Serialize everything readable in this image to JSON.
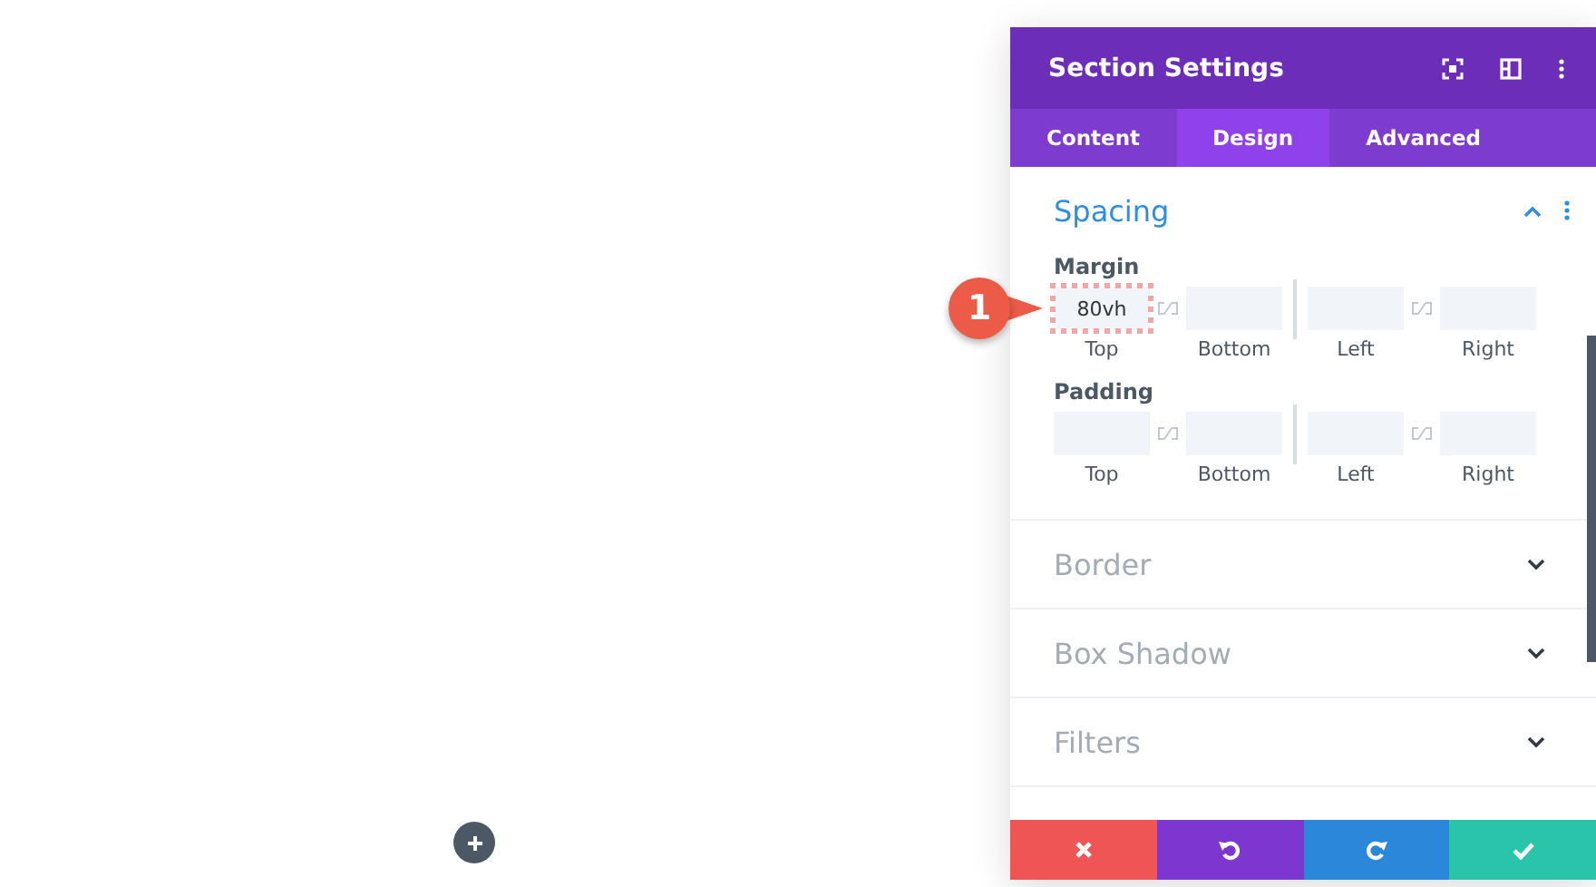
{
  "panel": {
    "title": "Section Settings",
    "tabs": [
      {
        "label": "Content",
        "selected": false
      },
      {
        "label": "Design",
        "selected": true
      },
      {
        "label": "Advanced",
        "selected": false
      }
    ],
    "sections": [
      {
        "title": "Spacing",
        "expanded": true,
        "groups": [
          {
            "label": "Margin",
            "fields": [
              {
                "value": "80vh",
                "label": "Top",
                "highlighted": true
              },
              {
                "label": "Bottom",
                "highlighted": false
              },
              {
                "label": "Left",
                "highlighted": false
              },
              {
                "label": "Right",
                "highlighted": false
              }
            ]
          },
          {
            "label": "Padding",
            "fields": [
              {
                "label": "Top",
                "highlighted": false
              },
              {
                "label": "Bottom",
                "highlighted": false
              },
              {
                "label": "Left",
                "highlighted": false
              },
              {
                "label": "Right",
                "highlighted": false
              }
            ]
          }
        ]
      },
      {
        "title": "Border",
        "expanded": false
      },
      {
        "title": "Box Shadow",
        "expanded": false
      },
      {
        "title": "Filters",
        "expanded": false
      }
    ],
    "footer": [
      {
        "kind": "cancel"
      },
      {
        "kind": "undo"
      },
      {
        "kind": "redo"
      },
      {
        "kind": "save"
      }
    ]
  },
  "callout": {
    "label": "1"
  }
}
